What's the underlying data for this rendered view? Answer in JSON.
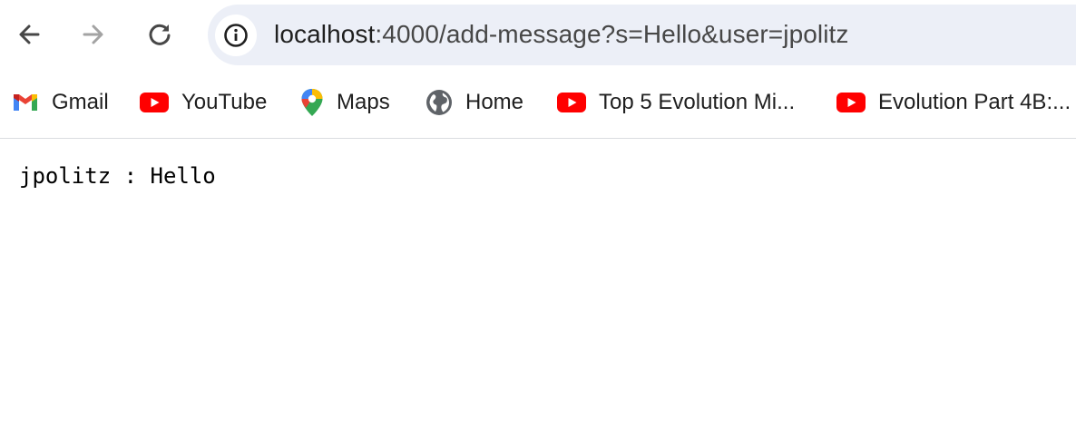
{
  "browser": {
    "nav": {
      "back": "back",
      "forward": "forward",
      "reload": "reload"
    },
    "address_bar": {
      "host": "localhost",
      "rest": ":4000/add-message?s=Hello&user=jpolitz"
    },
    "bookmarks": [
      {
        "label": "Gmail",
        "icon": "gmail-icon"
      },
      {
        "label": "YouTube",
        "icon": "youtube-icon"
      },
      {
        "label": "Maps",
        "icon": "maps-icon"
      },
      {
        "label": "Home",
        "icon": "globe-icon"
      },
      {
        "label": "Top 5 Evolution Mi...",
        "icon": "youtube-icon"
      },
      {
        "label": "Evolution Part 4B:...",
        "icon": "youtube-icon"
      }
    ]
  },
  "page": {
    "message": "jpolitz : Hello"
  },
  "colors": {
    "omnibox_bg": "#eceff7",
    "youtube_red": "#ff0000",
    "text": "#1f1f1f"
  }
}
